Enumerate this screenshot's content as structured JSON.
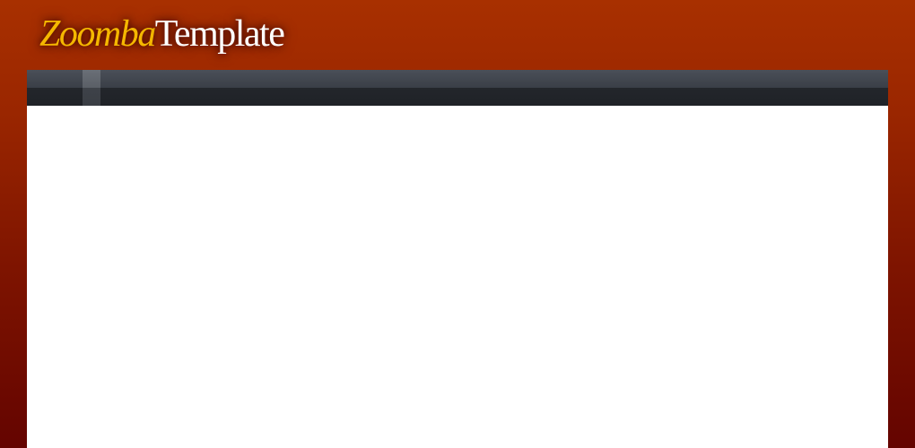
{
  "logo": {
    "brand": "Zoomba",
    "suffix": "Template"
  },
  "colors": {
    "background_top": "#a83000",
    "background_bottom": "#640400",
    "logo_brand": "#f5b800",
    "logo_suffix": "#ffffff",
    "navbar": "#2b2f35",
    "content": "#ffffff"
  },
  "navbar": {
    "items": [
      {
        "label": ""
      }
    ]
  }
}
